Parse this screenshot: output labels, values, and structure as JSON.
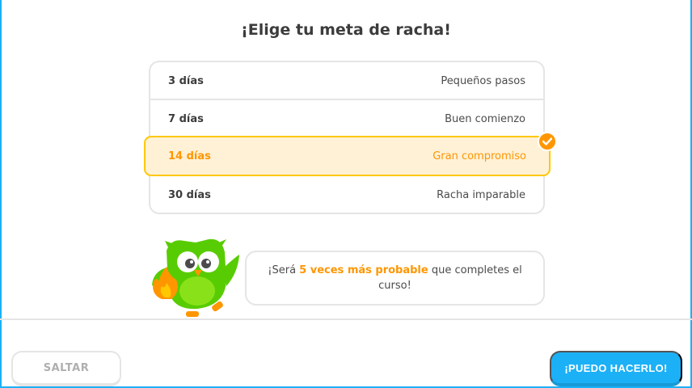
{
  "title": "¡Elige tu meta de racha!",
  "options": [
    {
      "days": "3 días",
      "label": "Pequeños pasos"
    },
    {
      "days": "7 días",
      "label": "Buen comienzo"
    },
    {
      "days": "14 días",
      "label": "Gran compromiso"
    },
    {
      "days": "30 días",
      "label": "Racha imparable"
    }
  ],
  "selected_index": 2,
  "bubble": {
    "before": "¡Será ",
    "highlight": "5 veces más probable",
    "after": " que completes el curso!"
  },
  "buttons": {
    "skip": "SALTAR",
    "confirm": "¡PUEDO HACERLO!"
  },
  "colors": {
    "accent": "#ff9600",
    "selected_bg": "#fff1d6",
    "selected_border": "#ffc800",
    "primary": "#1cb0f6",
    "owl_green": "#58cc02"
  },
  "icons": {
    "check": "checkmark-icon",
    "mascot": "owl-mascot"
  }
}
